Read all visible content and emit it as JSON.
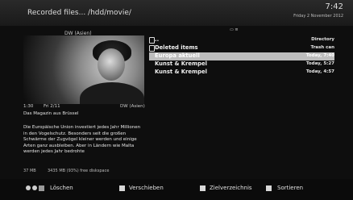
{
  "header": {
    "title": "Recorded files... /hdd/movie/",
    "time": "7:42",
    "date": "Friday 2 November 2012"
  },
  "preview": {
    "channel_label": "DW (Asien)",
    "time_info": "1:30",
    "day_info": "Fri 2/11",
    "channel_info": "DW (Asien)",
    "subtitle": "Das Magazin aus Brüssel",
    "description": "Die Europäische Union investiert jedes Jahr Millionen in den Vogelschutz. Besonders seit die großen Schwärme der Zugvögel kleiner werden und einige Arten ganz ausbleiben. Aber in Ländern wie Malta werden jedes Jahr bedrohte",
    "file_size": "37 MB",
    "free_space": "3435 MB (93%) free diskspace"
  },
  "top_icons": "▭ ≡",
  "list": {
    "items": [
      {
        "name": "..",
        "meta": "Directory"
      },
      {
        "name": "Deleted items",
        "meta": "Trash can"
      },
      {
        "name": "Europa aktuell",
        "meta": "Today, 7:40"
      },
      {
        "name": "Kunst & Krempel",
        "meta": "Today, 5:27"
      },
      {
        "name": "Kunst & Krempel",
        "meta": "Today, 4:57"
      }
    ],
    "selected_index": 2
  },
  "footer": {
    "delete_label": "Löschen",
    "move_label": "Verschieben",
    "target_dir_label": "Zielverzeichnis",
    "sort_label": "Sortieren"
  }
}
